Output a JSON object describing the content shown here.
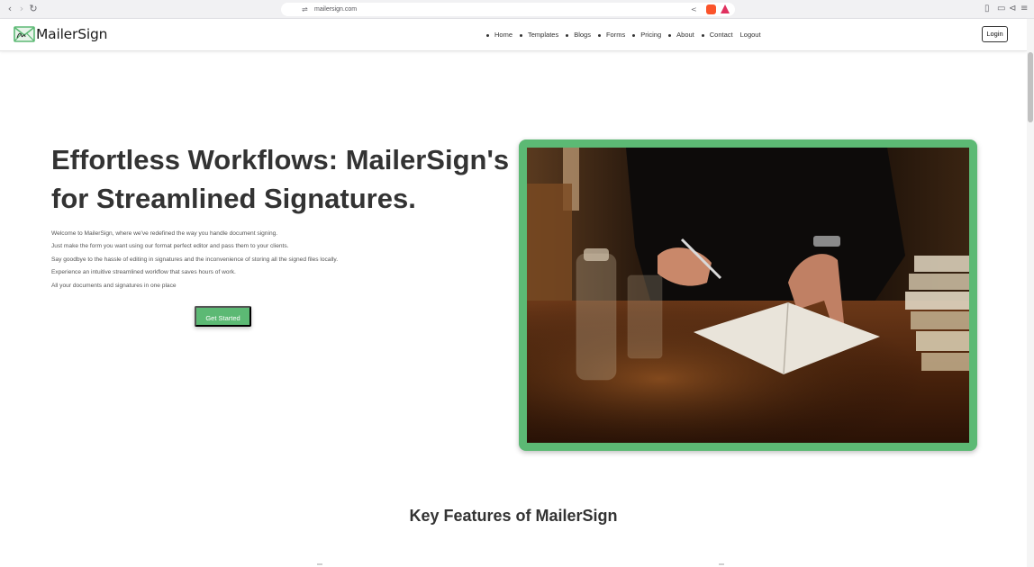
{
  "browser": {
    "url": "mailersign.com",
    "back_icon": "chevron-left-icon",
    "forward_icon": "chevron-right-icon",
    "reload_icon": "reload-icon"
  },
  "site": {
    "logo_text": "MailerSign",
    "nav": [
      {
        "label": "Home"
      },
      {
        "label": "Templates"
      },
      {
        "label": "Blogs"
      },
      {
        "label": "Forms"
      },
      {
        "label": "Pricing"
      },
      {
        "label": "About"
      },
      {
        "label": "Contact"
      },
      {
        "label": "Logout"
      }
    ],
    "login_label": "Login"
  },
  "hero": {
    "title": "Effortless Workflows: MailerSign's for Streamlined Signatures.",
    "lines": [
      "Welcome to MailerSign, where we've redefined the way you handle document signing.",
      "Just make the form you want using our format perfect editor and pass them to your clients.",
      "Say goodbye to the hassle of editing in signatures and the inconvenience of storing all the signed files locally.",
      "Experience an intuitive streamlined workflow that saves hours of work.",
      "All your documents and signatures in one place"
    ],
    "cta_label": "Get Started"
  },
  "features": {
    "title": "Key Features of MailerSign"
  },
  "colors": {
    "accent": "#5cb974",
    "text": "#333333"
  }
}
